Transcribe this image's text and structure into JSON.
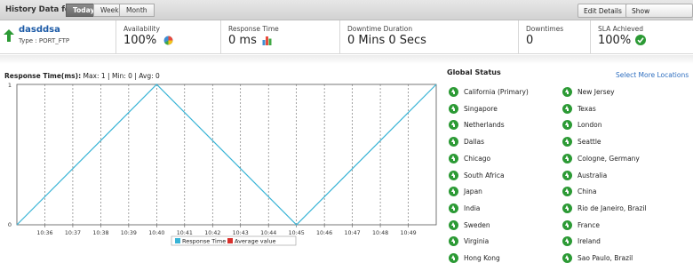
{
  "history": {
    "label": "History Data for:",
    "tabs": [
      "Today",
      "Week",
      "Month"
    ],
    "active_tab": "Today",
    "edit_details": "Edit Details",
    "show_configuration": "Show Configuration"
  },
  "summary": {
    "monitor_name": "dasddsa",
    "monitor_type": "Type : PORT_FTP",
    "availability_label": "Availability",
    "availability_value": "100%",
    "response_label": "Response Time",
    "response_value": "0 ms",
    "downtime_duration_label": "Downtime Duration",
    "downtime_duration_value": "0 Mins 0 Secs",
    "downtimes_label": "Downtimes",
    "downtimes_value": "0",
    "sla_label": "SLA Achieved",
    "sla_value": "100%"
  },
  "chart_header": {
    "title": "Response Time(ms):",
    "stats": "Max: 1 | Min: 0 | Avg: 0"
  },
  "chart_data": {
    "type": "line",
    "x": [
      "10:36",
      "10:37",
      "10:38",
      "10:39",
      "10:40",
      "10:41",
      "10:42",
      "10:43",
      "10:44",
      "10:45",
      "10:46",
      "10:47",
      "10:48",
      "10:49"
    ],
    "points": [
      {
        "x": "10:35",
        "y": 0
      },
      {
        "x": "10:40",
        "y": 1
      },
      {
        "x": "10:45",
        "y": 0
      },
      {
        "x": "10:50",
        "y": 1
      }
    ],
    "ylim": [
      0,
      1
    ],
    "yticks": [
      "0",
      "1"
    ],
    "series": [
      {
        "name": "Response Time",
        "color": "#39b4d6"
      },
      {
        "name": "Average value",
        "color": "#d9302c"
      }
    ],
    "grid": "vertical dashed",
    "legend": "bottom-center"
  },
  "global_status": {
    "title": "Global Status",
    "select_link": "Select More Locations",
    "left": [
      "California (Primary)",
      "Singapore",
      "Netherlands",
      "Dallas",
      "Chicago",
      "South Africa",
      "Japan",
      "India",
      "Sweden",
      "Virginia",
      "Hong Kong"
    ],
    "right": [
      "New Jersey",
      "Texas",
      "London",
      "Seattle",
      "Cologne, Germany",
      "Australia",
      "China",
      "Rio de Janeiro, Brazil",
      "France",
      "Ireland",
      "Sao Paulo, Brazil"
    ],
    "status_color": "#2c9a35"
  }
}
